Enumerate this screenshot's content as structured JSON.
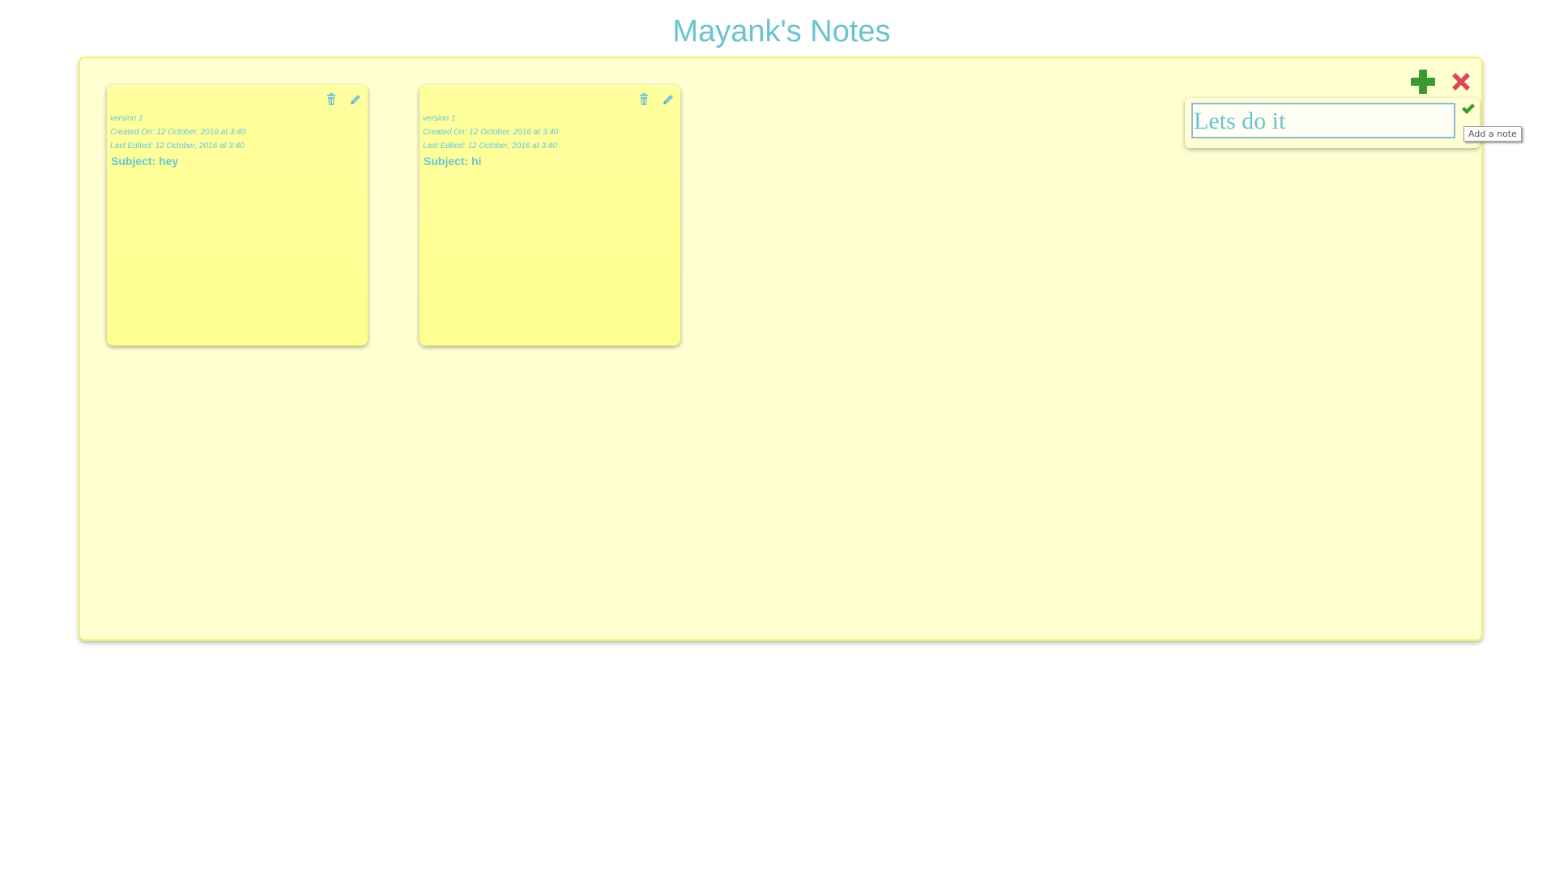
{
  "app": {
    "title": "Mayank's Notes"
  },
  "notes": [
    {
      "version": "version 1",
      "created": "Created On: 12 October, 2016 at 3:40",
      "edited": "Last Edited: 12 October, 2016 at 3:40",
      "subject": "Subject: hey",
      "icons": [
        "trash-icon",
        "pencil-icon"
      ]
    },
    {
      "version": "version 1",
      "created": "Created On: 12 October, 2016 at 3:40",
      "edited": "Last Edited: 12 October, 2016 at 3:40",
      "subject": "Subject: hi",
      "icons": [
        "trash-icon",
        "pencil-icon"
      ]
    }
  ],
  "toolbar": {
    "add_icon": "plus-icon",
    "close_icon": "close-icon"
  },
  "add_panel": {
    "input_placeholder": "Lets do it",
    "confirm_icon": "check-icon",
    "cancel_icon": "close-icon"
  },
  "tooltip": {
    "text": "Add a note"
  },
  "colors": {
    "title": "#6ac4cf",
    "board_bg": "#ffffd2",
    "board_border": "#f5f06a",
    "note_bg": "#ffff9f",
    "add_green": "#3a9a2e",
    "close_red": "#e0455a",
    "text": "#6ac4cf"
  }
}
